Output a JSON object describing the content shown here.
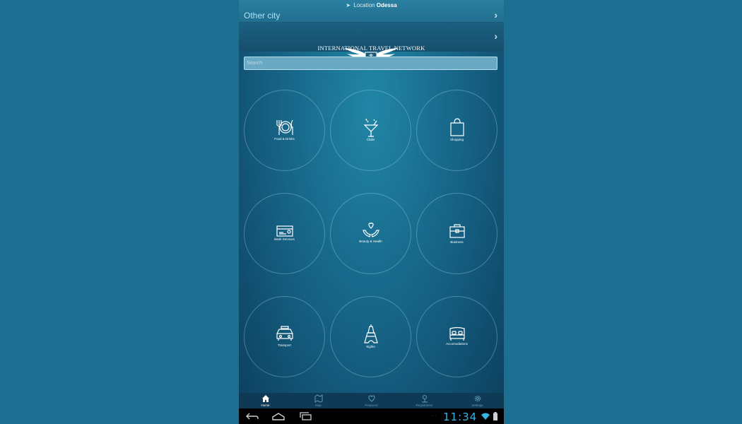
{
  "location": {
    "label": "Location",
    "city": "Odessa"
  },
  "other_city": "Other city",
  "banner": {
    "title": "INTERNATIONAL TRAVEL NETWORK"
  },
  "search": {
    "placeholder": "Search"
  },
  "categories": [
    {
      "label": "Food & Drinks",
      "icon": "utensils-plate-icon"
    },
    {
      "label": "Clubs",
      "icon": "cocktail-icon"
    },
    {
      "label": "Shopping",
      "icon": "shopping-bag-icon"
    },
    {
      "label": "Bank Services",
      "icon": "credit-card-icon"
    },
    {
      "label": "Beauty & Health",
      "icon": "hands-heart-icon"
    },
    {
      "label": "Business",
      "icon": "briefcase-icon"
    },
    {
      "label": "Transport",
      "icon": "taxi-icon"
    },
    {
      "label": "Sights",
      "icon": "eiffel-tower-icon"
    },
    {
      "label": "Accomodations",
      "icon": "bed-icon"
    }
  ],
  "tabs": [
    {
      "label": "Home",
      "icon": "home-icon",
      "active": true
    },
    {
      "label": "Map",
      "icon": "map-icon",
      "active": false
    },
    {
      "label": "Featured",
      "icon": "heart-icon",
      "active": false
    },
    {
      "label": "Registration",
      "icon": "user-pin-icon",
      "active": false
    },
    {
      "label": "Settings",
      "icon": "gear-icon",
      "active": false
    }
  ],
  "status": {
    "time": "11:34"
  },
  "colors": {
    "accent": "#35b5e5",
    "background": "#1d6f92"
  }
}
